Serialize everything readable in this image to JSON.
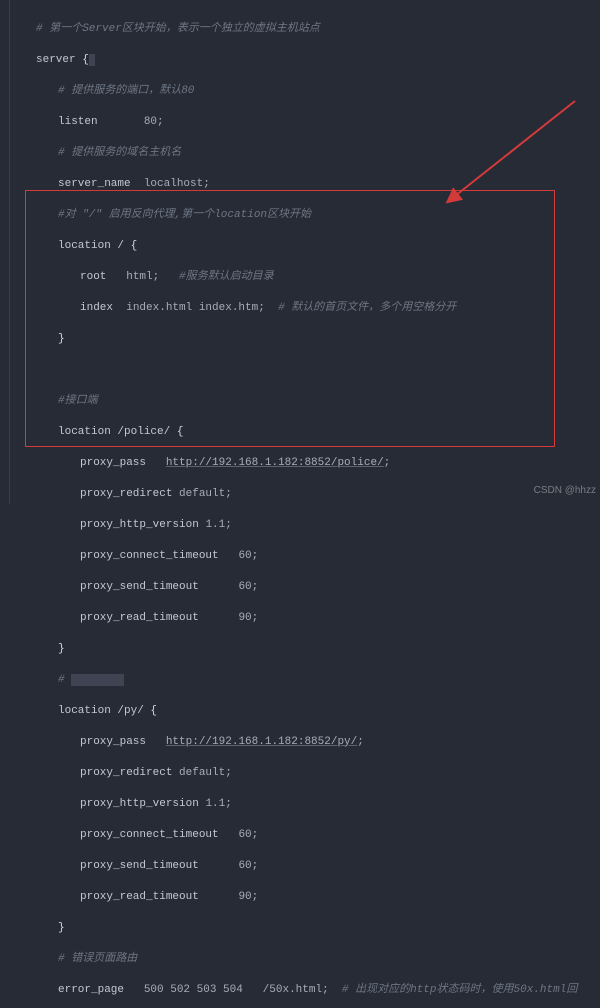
{
  "watermark": "CSDN @hhzz",
  "code": {
    "c1": "# 第一个Server区块开始，表示一个独立的虚拟主机站点",
    "server": "server",
    "brace_open": "{",
    "c2": "# 提供服务的端口，默认80",
    "listen_k": "listen",
    "listen_v": "80",
    "c3": "# 提供服务的域名主机名",
    "sname_k": "server_name",
    "sname_v": "localhost",
    "c4": "#对 \"/\" 启用反向代理,第一个location区块开始",
    "loc_root": "location / ",
    "root_k": "root",
    "root_v": "html",
    "c5": "#服务默认启动目录",
    "index_k": "index",
    "index_v": "index.html index.htm",
    "c6": "# 默认的首页文件，多个用空格分开",
    "brace_close": "}",
    "c7": "#接口端",
    "loc_police": "location /police/ ",
    "ppass_k": "proxy_pass",
    "ppass_police": "http://192.168.1.182:8852/police/",
    "pred_k": "proxy_redirect",
    "pred_v": "default",
    "phver_k": "proxy_http_version",
    "phver_v": "1.1",
    "pcon_k": "proxy_connect_timeout",
    "pcon_v": "60",
    "psend_k": "proxy_send_timeout",
    "psend_v": "60",
    "pread_k": "proxy_read_timeout",
    "pread_v": "90",
    "loc_py": "location /py/ ",
    "ppass_py": "http://192.168.1.182:8852/py/",
    "c8": "# 错误页面路由",
    "errp_k": "error_page",
    "errp_codes": "500 502 503 504",
    "errp_path": "/50x.html",
    "c9": "# 出现对应的http状态码时，使用50x.html回"
  }
}
